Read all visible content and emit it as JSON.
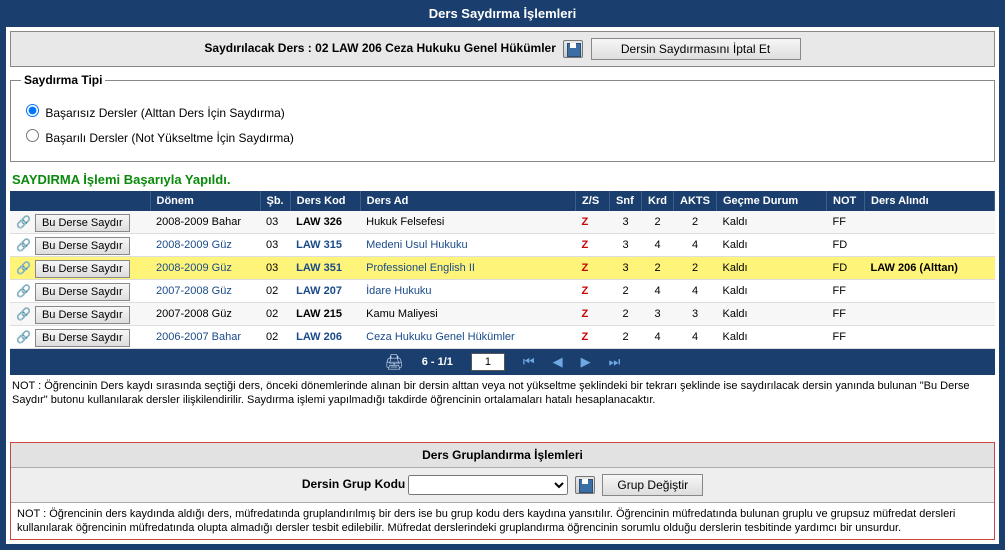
{
  "header": {
    "title": "Ders Saydırma İşlemleri"
  },
  "topAction": {
    "prefix": "Saydırılacak Ders : ",
    "course": "02 LAW 206 Ceza Hukuku Genel Hükümler",
    "cancelBtn": "Dersin Saydırmasını İptal Et"
  },
  "sayTipi": {
    "legend": "Saydırma Tipi",
    "opt1": "Başarısız Dersler (Alttan Ders İçin Saydırma)",
    "opt2": "Başarılı Dersler (Not Yükseltme İçin Saydırma)"
  },
  "successMsg": "SAYDIRMA İşlemi Başarıyla Yapıldı.",
  "cols": {
    "c0": "",
    "c1": "Dönem",
    "c2": "Şb.",
    "c3": "Ders Kod",
    "c4": "Ders Ad",
    "c5": "Z/S",
    "c6": "Snf",
    "c7": "Krd",
    "c8": "AKTS",
    "c9": "Geçme Durum",
    "c10": "NOT",
    "c11": "Ders Alındı"
  },
  "rowBtnLabel": "Bu Derse Saydır",
  "rows": [
    {
      "donem": "2008-2009 Bahar",
      "donemLink": false,
      "sb": "03",
      "kod": "LAW 326",
      "kodLink": false,
      "ad": "Hukuk Felsefesi",
      "adLink": false,
      "zs": "Z",
      "snf": "3",
      "krd": "2",
      "akts": "2",
      "gecme": "Kaldı",
      "not": "FF",
      "alindi": "",
      "hl": false
    },
    {
      "donem": "2008-2009 Güz",
      "donemLink": true,
      "sb": "03",
      "kod": "LAW 315",
      "kodLink": true,
      "ad": "Medeni Usul Hukuku",
      "adLink": true,
      "zs": "Z",
      "snf": "3",
      "krd": "4",
      "akts": "4",
      "gecme": "Kaldı",
      "not": "FD",
      "alindi": "",
      "hl": false
    },
    {
      "donem": "2008-2009 Güz",
      "donemLink": true,
      "sb": "03",
      "kod": "LAW 351",
      "kodLink": true,
      "ad": "Professionel English II",
      "adLink": true,
      "zs": "Z",
      "snf": "3",
      "krd": "2",
      "akts": "2",
      "gecme": "Kaldı",
      "not": "FD",
      "alindi": "LAW 206 (Alttan)",
      "hl": true
    },
    {
      "donem": "2007-2008 Güz",
      "donemLink": true,
      "sb": "02",
      "kod": "LAW 207",
      "kodLink": true,
      "ad": "İdare Hukuku",
      "adLink": true,
      "zs": "Z",
      "snf": "2",
      "krd": "4",
      "akts": "4",
      "gecme": "Kaldı",
      "not": "FF",
      "alindi": "",
      "hl": false
    },
    {
      "donem": "2007-2008 Güz",
      "donemLink": false,
      "sb": "02",
      "kod": "LAW 215",
      "kodLink": false,
      "ad": "Kamu Maliyesi",
      "adLink": false,
      "zs": "Z",
      "snf": "2",
      "krd": "3",
      "akts": "3",
      "gecme": "Kaldı",
      "not": "FF",
      "alindi": "",
      "hl": false
    },
    {
      "donem": "2006-2007 Bahar",
      "donemLink": true,
      "sb": "02",
      "kod": "LAW 206",
      "kodLink": true,
      "ad": "Ceza Hukuku Genel Hükümler",
      "adLink": true,
      "zs": "Z",
      "snf": "2",
      "krd": "4",
      "akts": "4",
      "gecme": "Kaldı",
      "not": "FF",
      "alindi": "",
      "hl": false
    }
  ],
  "nav": {
    "pageRange": "6 - 1/1",
    "pageInput": "1"
  },
  "note1": "NOT : Öğrencinin Ders kaydı sırasında seçtiği ders, önceki dönemlerinde alınan bir dersin alttan veya not yükseltme şeklindeki bir  tekrarı şeklinde ise saydırılacak dersin yanında bulunan \"Bu Derse Saydır\" butonu kullanılarak dersler ilişkilendirilir. Saydırma işlemi yapılmadığı takdirde öğrencinin ortalamaları hatalı hesaplanacaktır.",
  "group": {
    "header": "Ders Gruplandırma İşlemleri",
    "label": "Dersin Grup Kodu",
    "changeBtn": "Grup Değiştir"
  },
  "note2": "NOT : Öğrencinin ders kaydında aldığı ders, müfredatında  gruplandırılmış bir ders ise bu grup kodu ders kaydına yansıtılır. Öğrencinin müfredatında bulunan gruplu ve grupsuz müfredat dersleri  kullanılarak öğrencinin müfredatında olupta almadığı dersler tesbit edilebilir. Müfredat derslerindeki gruplandırma öğrencinin sorumlu olduğu derslerin tesbitinde yardımcı bir unsurdur."
}
